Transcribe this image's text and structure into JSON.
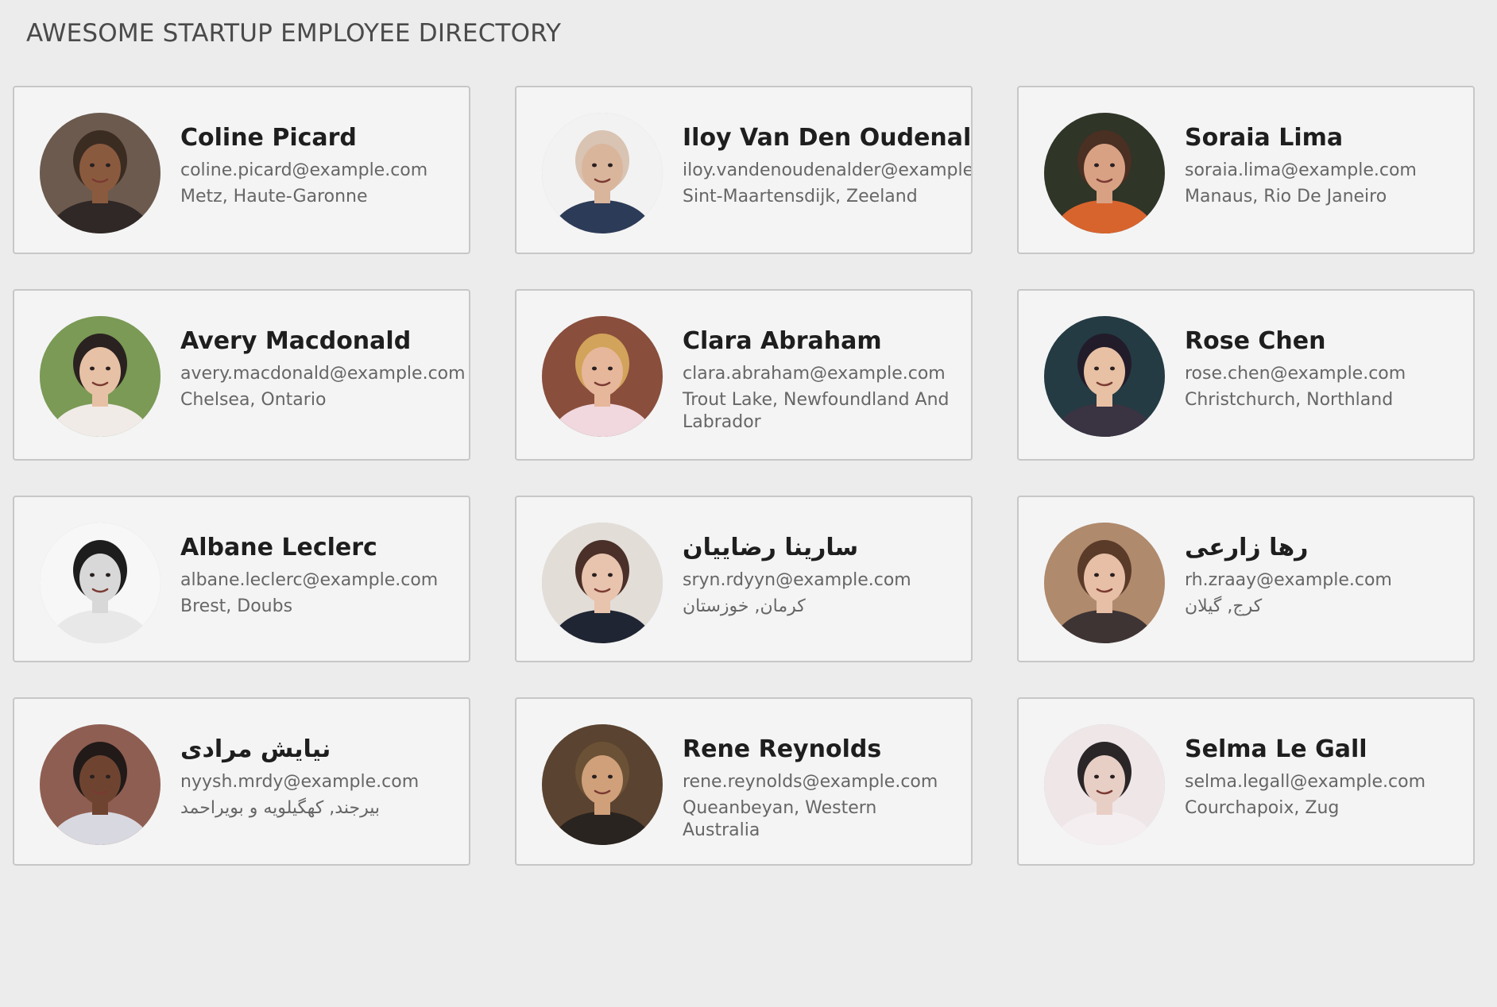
{
  "header": {
    "title": "AWESOME STARTUP EMPLOYEE DIRECTORY"
  },
  "employees": [
    {
      "name": "Coline Picard",
      "email": "coline.picard@example.com",
      "location": "Metz, Haute-Garonne",
      "avatar_icon": "portrait-photo",
      "avatar_colors": {
        "bg": "#6c5a4e",
        "skin": "#8a5a3f",
        "hair": "#3b2c22",
        "clothes": "#2f2826"
      }
    },
    {
      "name": "Iloy Van Den Oudenalder",
      "email": "iloy.vandenoudenalder@example.com",
      "location": "Sint-Maartensdijk, Zeeland",
      "avatar_icon": "portrait-photo",
      "avatar_colors": {
        "bg": "#f2f2f2",
        "skin": "#d9b59c",
        "hair": "#d9c3b2",
        "clothes": "#2c3b57"
      }
    },
    {
      "name": "Soraia Lima",
      "email": "soraia.lima@example.com",
      "location": "Manaus, Rio De Janeiro",
      "avatar_icon": "portrait-photo",
      "avatar_colors": {
        "bg": "#2f3527",
        "skin": "#d9a184",
        "hair": "#4a2f23",
        "clothes": "#d8642d"
      }
    },
    {
      "name": "Avery Macdonald",
      "email": "avery.macdonald@example.com",
      "location": "Chelsea, Ontario",
      "avatar_icon": "portrait-photo",
      "avatar_colors": {
        "bg": "#7a9a55",
        "skin": "#e7c1a5",
        "hair": "#2a2220",
        "clothes": "#f1ebe8"
      }
    },
    {
      "name": "Clara Abraham",
      "email": "clara.abraham@example.com",
      "location": "Trout Lake, Newfoundland And Labrador",
      "avatar_icon": "portrait-photo",
      "avatar_colors": {
        "bg": "#8a4e3c",
        "skin": "#e6b79a",
        "hair": "#d2a35a",
        "clothes": "#f0d8de"
      }
    },
    {
      "name": "Rose Chen",
      "email": "rose.chen@example.com",
      "location": "Christchurch, Northland",
      "avatar_icon": "portrait-photo",
      "avatar_colors": {
        "bg": "#243b44",
        "skin": "#e8c0a4",
        "hair": "#221c2a",
        "clothes": "#3a3342"
      }
    },
    {
      "name": "Albane Leclerc",
      "email": "albane.leclerc@example.com",
      "location": "Brest, Doubs",
      "avatar_icon": "portrait-photo",
      "avatar_colors": {
        "bg": "#f7f7f7",
        "skin": "#d8d8d8",
        "hair": "#1d1d1d",
        "clothes": "#e8e8e8"
      }
    },
    {
      "name": "سارینا رضاییان",
      "email": "sryn.rdyyn@example.com",
      "location": "کرمان, خوزستان",
      "avatar_icon": "portrait-photo",
      "avatar_colors": {
        "bg": "#e3ddd8",
        "skin": "#e8c3ad",
        "hair": "#4a3028",
        "clothes": "#1f2533"
      }
    },
    {
      "name": "رها زارعی",
      "email": "rh.zraay@example.com",
      "location": "کرج, گیلان",
      "avatar_icon": "portrait-photo",
      "avatar_colors": {
        "bg": "#b08a6c",
        "skin": "#e7bfa6",
        "hair": "#5a3b2a",
        "clothes": "#3e3434"
      }
    },
    {
      "name": "نیایش مرادی",
      "email": "nyysh.mrdy@example.com",
      "location": "بیرجند, کهگیلویه و بویراحمد",
      "avatar_icon": "portrait-photo",
      "avatar_colors": {
        "bg": "#8f5e52",
        "skin": "#6e4431",
        "hair": "#211a18",
        "clothes": "#d8d8e0"
      }
    },
    {
      "name": "Rene Reynolds",
      "email": "rene.reynolds@example.com",
      "location": "Queanbeyan, Western Australia",
      "avatar_icon": "portrait-photo",
      "avatar_colors": {
        "bg": "#5a4330",
        "skin": "#d0a07a",
        "hair": "#6b5236",
        "clothes": "#2a2420"
      }
    },
    {
      "name": "Selma Le Gall",
      "email": "selma.legall@example.com",
      "location": "Courchapoix, Zug",
      "avatar_icon": "portrait-photo",
      "avatar_colors": {
        "bg": "#efe6e8",
        "skin": "#e8cfc6",
        "hair": "#2a2628",
        "clothes": "#f4eef0"
      }
    }
  ]
}
